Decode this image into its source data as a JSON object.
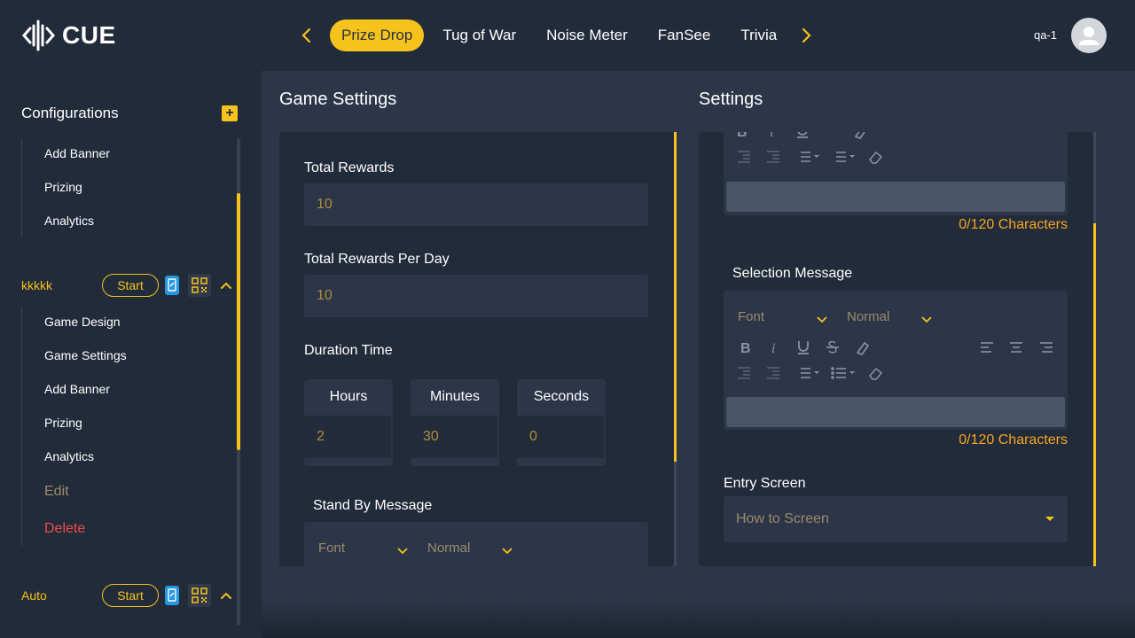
{
  "header": {
    "logo_text": "CUE",
    "tabs": [
      {
        "label": "Prize Drop",
        "active": true
      },
      {
        "label": "Tug of War",
        "active": false
      },
      {
        "label": "Noise Meter",
        "active": false
      },
      {
        "label": "FanSee",
        "active": false
      },
      {
        "label": "Trivia",
        "active": false
      }
    ],
    "username": "qa-1"
  },
  "sidebar": {
    "title": "Configurations",
    "first_group_items": [
      "Add Banner",
      "Prizing",
      "Analytics"
    ],
    "games": [
      {
        "name": "kkkkk",
        "start_label": "Start",
        "expanded": true,
        "items": [
          "Game Design",
          "Game Settings",
          "Add Banner",
          "Prizing",
          "Analytics"
        ],
        "edit_label": "Edit",
        "delete_label": "Delete"
      },
      {
        "name": "Auto",
        "start_label": "Start",
        "expanded": true
      }
    ]
  },
  "game_settings": {
    "title": "Game Settings",
    "total_rewards": {
      "label": "Total Rewards",
      "value": "10"
    },
    "total_rewards_per_day": {
      "label": "Total Rewards Per Day",
      "value": "10"
    },
    "duration": {
      "label": "Duration Time",
      "hours": {
        "label": "Hours",
        "value": "2"
      },
      "minutes": {
        "label": "Minutes",
        "value": "30"
      },
      "seconds": {
        "label": "Seconds",
        "value": "0"
      }
    },
    "standby_message": {
      "label": "Stand By Message",
      "font": "Font",
      "size": "Normal"
    }
  },
  "settings": {
    "title": "Settings",
    "first_editor_count": "0/120 Characters",
    "selection_message": {
      "label": "Selection Message",
      "font": "Font",
      "size": "Normal",
      "count": "0/120 Characters"
    },
    "entry_screen": {
      "label": "Entry Screen",
      "value": "How to Screen"
    }
  },
  "colors": {
    "accent": "#f6c21c",
    "background": "#222b3a",
    "panel": "#2c3648",
    "danger": "#f04a4a",
    "counter": "#f6a623"
  }
}
